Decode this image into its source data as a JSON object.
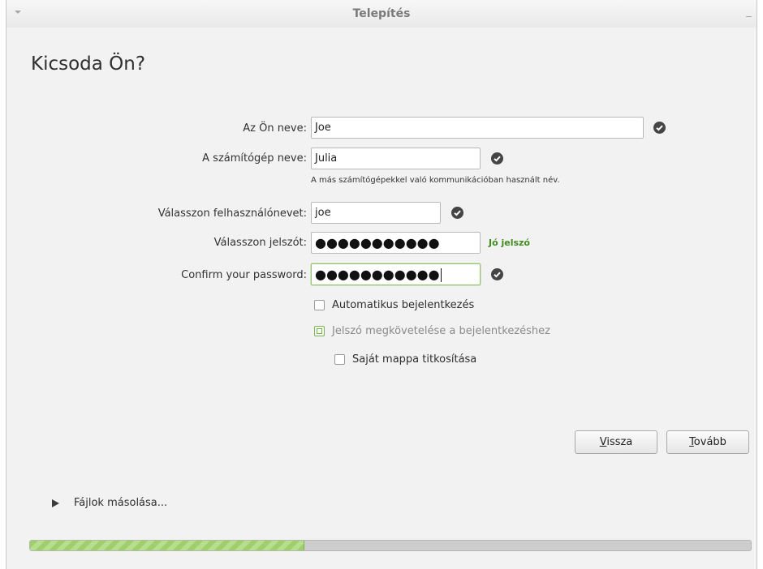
{
  "window": {
    "title": "Telepítés"
  },
  "page": {
    "heading": "Kicsoda Ön?"
  },
  "form": {
    "name_label": "Az Ön neve:",
    "name_value": "Joe",
    "computer_label": "A számítógép neve:",
    "computer_value": "Julia",
    "computer_hint": "A más számítógépekkel való kommunikációban használt név.",
    "username_label": "Válasszon felhasználónevet:",
    "username_value": "joe",
    "password_label": "Válasszon jelszót:",
    "password_value": "●●●●●●●●●●●",
    "password_strength": "Jó jelszó",
    "confirm_label": "Confirm your password:",
    "confirm_value": "●●●●●●●●●●●"
  },
  "options": {
    "auto_login": {
      "label": "Automatikus bejelentkezés",
      "checked": false
    },
    "require_password": {
      "label": "Jelszó megkövetelése a bejelentkezéshez",
      "checked": true
    },
    "encrypt_home": {
      "label": "Saját mappa titkosítása",
      "checked": false
    }
  },
  "buttons": {
    "back_first": "V",
    "back_rest": "issza",
    "next_first": "T",
    "next_rest": "ovább"
  },
  "status": {
    "expander_label": "Fájlok másolása...",
    "progress": 0.38
  },
  "colors": {
    "valid_icon": "#454545",
    "strength_text": "#3f8c1c",
    "progress_fill": "#9fcf6a"
  }
}
